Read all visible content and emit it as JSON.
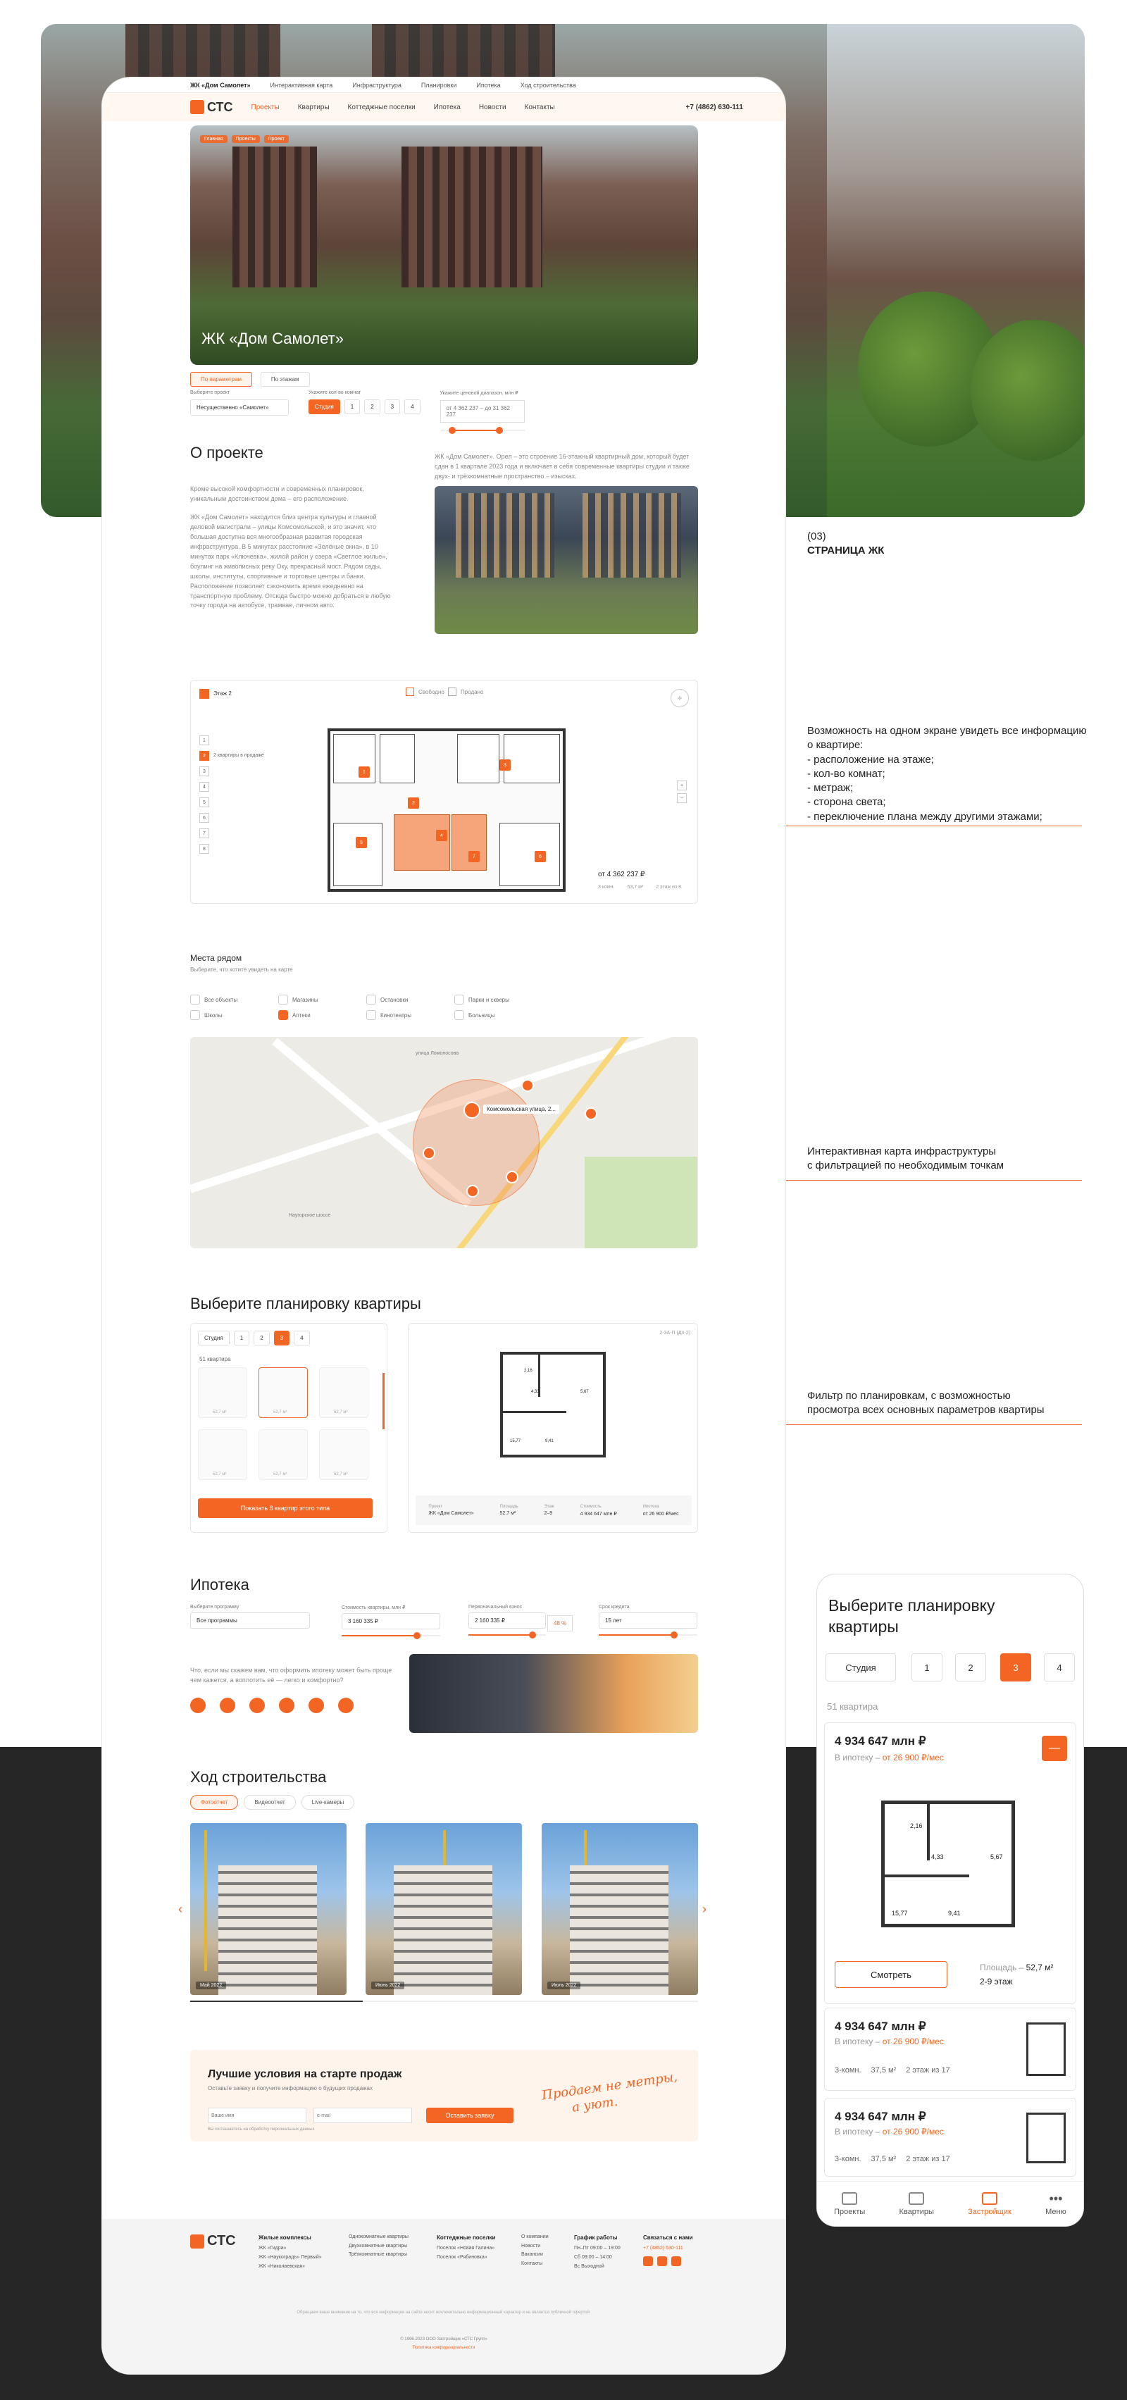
{
  "top_bar": {
    "project": "ЖК «Дом Самолет»",
    "links": [
      "Интерактивная карта",
      "Инфраструктура",
      "Планировки",
      "Ипотека",
      "Ход строительства"
    ]
  },
  "nav": {
    "brand": "СТС",
    "items": [
      "Проекты",
      "Квартиры",
      "Коттеджные поселки",
      "Ипотека",
      "Новости",
      "Контакты"
    ],
    "phone": "+7 (4862) 630-111"
  },
  "hero": {
    "title": "ЖК «Дом Самолет»",
    "breadcrumbs": [
      "Главная",
      "Проекты",
      "Проект"
    ]
  },
  "filters": {
    "tabs": [
      "По параметрам",
      "По этажам"
    ],
    "project_label": "Выберите проект",
    "project_value": "Несущественно «Самолет»",
    "rooms_label": "Укажите кол-во комнат",
    "rooms": [
      "Студия",
      "1",
      "2",
      "3",
      "4"
    ],
    "price_label": "Укажите ценовой диапазон, млн ₽",
    "price_value": "от 4 362 237 – до 31 362 237"
  },
  "about": {
    "title": "О проекте",
    "para1": "Кроме высокой комфортности и современных планировок, уникальным достоинством дома – его расположение.",
    "para2": "ЖК «Дом Самолет» находится близ центра культуры и главной деловой магистрали – улицы Комсомольской, и это значит, что большая доступна вся многообразная развитая городская инфраструктура. В 5 минутах расстояние «Зелёные окна», в 10 минутах парк «Ключевка», жилой район у озера «Светлое жилье», боулинг на живописных реку Оку, прекрасный мост. Рядом сады, школы, институты, спортивные и торговые центры и банки. Расположение позволяет сэкономить время ежедневно на транспортную проблему. Отсюда быстро можно добраться в любую точку города на автобусе, трамвае, личном авто.",
    "side_text": "ЖК «Дом Самолет». Орел – это строение 16-этажный квартирный дом, который будет сдан в 1 квартале 2023 года и включает в себя современные квартиры студии и также двух- и трёхкомнатные пространство – изысках."
  },
  "floorplan": {
    "legend": [
      "Свободно",
      "Продано"
    ],
    "floor_label": "Этаж 2",
    "floors": [
      "1",
      "2",
      "3",
      "4",
      "5",
      "6",
      "7",
      "8"
    ],
    "active_floor_note": "2 квартиры в продаже",
    "price": "от 4 362 237 ₽",
    "meta": [
      "3 комн.",
      "53,7 м²",
      "2 этаж из 8"
    ],
    "apt_numbers": [
      "1",
      "2",
      "3",
      "4",
      "5",
      "6",
      "7"
    ]
  },
  "places": {
    "title": "Места рядом",
    "subtitle": "Выберите, что хотите увидеть на карте",
    "categories": [
      "Все объекты",
      "Магазины",
      "Остановки",
      "Парки и скверы",
      "Школы",
      "Аптеки",
      "Кинотеатры",
      "Больницы"
    ],
    "map_label": "Комсомольская улица, 2...",
    "street_labels": [
      "Комсомольская улица",
      "Наугорское шоссе",
      "улица Ломоносова"
    ]
  },
  "layouts": {
    "title": "Выберите планировку квартиры",
    "rooms": [
      "Студия",
      "1",
      "2",
      "3",
      "4"
    ],
    "count": "51 квартира",
    "thumb_area": "52,7 м²",
    "button": "Показать 8 квартир этого типа",
    "plan_code": "2-3А-П (Д4-2)",
    "room_sizes": [
      "2,16",
      "4,33",
      "5,67",
      "15,77",
      "9,41"
    ],
    "specs": [
      {
        "label": "Проект",
        "value": "ЖК «Дом Самолет»"
      },
      {
        "label": "Площадь",
        "value": "52,7 м²"
      },
      {
        "label": "Этаж",
        "value": "2–9"
      },
      {
        "label": "Стоимость",
        "value": "4 934 647 млн ₽"
      },
      {
        "label": "Ипотека",
        "value": "от 26 900 ₽/мес"
      }
    ]
  },
  "mortgage": {
    "title": "Ипотека",
    "fields": [
      {
        "label": "Выберите программу",
        "value": "Все программы"
      },
      {
        "label": "Стоимость квартиры, млн ₽",
        "value": "3 160 335 ₽"
      },
      {
        "label": "Первоначальный взнос",
        "value": "2 160 335 ₽"
      },
      {
        "label": "Срок кредита",
        "value": "15 лет"
      }
    ],
    "percent": "48 %",
    "note": "Что, если мы скажем вам, что оформить ипотеку может быть проще чем кажется, а воплотить её — легко и комфортно?"
  },
  "construction": {
    "title": "Ход строительства",
    "tabs": [
      "Фотоотчет",
      "Видеоотчет",
      "Live-камеры"
    ],
    "photos": [
      {
        "date": "Май 2022"
      },
      {
        "date": "Июнь 2022"
      },
      {
        "date": "Июль 2022"
      }
    ]
  },
  "cta": {
    "title": "Лучшие условия на старте продаж",
    "subtitle": "Оставьте заявку и получите информацию о будущих продажах",
    "name_placeholder": "Ваше имя",
    "email_placeholder": "e-mail",
    "button": "Оставить заявку",
    "consent": "Вы соглашаетесь на обработку персональных данных",
    "script_text_1": "Продаем не метры,",
    "script_text_2": "а уют."
  },
  "footer": {
    "brand": "СТС",
    "col1_title": "Жилые комплексы",
    "col1": [
      "ЖК «Гидра»",
      "ЖК «Наукоградъ» Первый»",
      "ЖК «Николаевская»"
    ],
    "col2_title": "",
    "col2": [
      "Однокомнатные квартиры",
      "Двухкомнатные квартиры",
      "Трёхкомнатные квартиры"
    ],
    "col3_title": "Коттеджные поселки",
    "col3": [
      "Поселок «Новая Галина»",
      "Поселок «Рябиновка»"
    ],
    "col4": [
      "О компании",
      "Новости",
      "Вакансии",
      "Контакты"
    ],
    "col5_title": "График работы",
    "col5": [
      "Пн–Пт 09:00 – 19:00",
      "Сб 09:00 – 14:00",
      "Вс Выходной"
    ],
    "col6_title": "Связаться с нами",
    "col6_phone": "+7 (4862) 630-111",
    "legal": "Обращаем ваше внимание на то, что вся информация на сайте носит исключительно информационный характер и не является публичной офертой.",
    "copyright": "© 1996-2023 ООО Застройщик «СТС Групп»",
    "privacy": "Политика конфиденциальности"
  },
  "annotations": {
    "label_num": "(03)",
    "label_title": "СТРАНИЦА ЖК",
    "a1_title": "Возможность на одном экране увидеть все информацию о квартире:",
    "a1_items": [
      "- расположение на этаже;",
      "- кол-во комнат;",
      "- метраж;",
      "- сторона света;",
      "- переключение плана между другими этажами;"
    ],
    "a2": [
      "Интерактивная карта инфраструктуры",
      "с фильтрацией по необходимым точкам"
    ],
    "a3": [
      "Фильтр по планировкам, с возможностью",
      "просмотра всех основных параметров квартиры"
    ]
  },
  "mobile": {
    "title": "Выберите планировку квартиры",
    "rooms": [
      "Студия",
      "1",
      "2",
      "3",
      "4"
    ],
    "count": "51 квартира",
    "cards": [
      {
        "price": "4 934 647 млн ₽",
        "mortgage_prefix": "В ипотеку – ",
        "mortgage": "от 26 900 ₽/мес",
        "area_label": "Площадь –",
        "area": "52,7 м²",
        "floor": "2-9 этаж",
        "button": "Смотреть",
        "sizes": [
          "2,16",
          "4,33",
          "5,67",
          "15,77",
          "9,41"
        ]
      },
      {
        "price": "4 934 647 млн ₽",
        "mortgage_prefix": "В ипотеку – ",
        "mortgage": "от 26 900 ₽/мес",
        "meta": [
          "3-комн.",
          "37,5 м²",
          "2 этаж из 17"
        ]
      },
      {
        "price": "4 934 647 млн ₽",
        "mortgage_prefix": "В ипотеку – ",
        "mortgage": "от 26 900 ₽/мес",
        "meta": [
          "3-комн.",
          "37,5 м²",
          "2 этаж из 17"
        ]
      }
    ],
    "nav": [
      "Проекты",
      "Квартиры",
      "Застройщик",
      "Меню"
    ]
  },
  "colors": {
    "accent": "#f26522",
    "dark_band": "#262626"
  }
}
